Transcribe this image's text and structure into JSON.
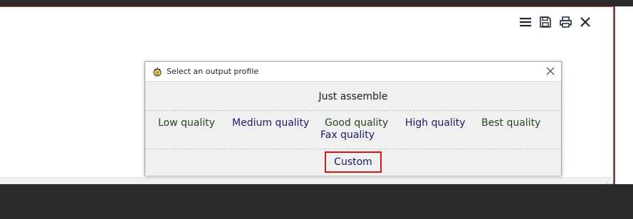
{
  "toolbar": {
    "menu_icon": "hamburger-icon",
    "save_icon": "save-icon",
    "print_icon": "print-icon",
    "close_icon": "close-icon"
  },
  "dialog": {
    "title": "Select an output profile",
    "icon": "app-logo-icon",
    "just_assemble": "Just assemble",
    "options": [
      "Low quality",
      "Medium quality",
      "Good quality",
      "High quality",
      "Best quality",
      "Fax quality"
    ],
    "custom": "Custom",
    "highlight_color": "#d6141b"
  },
  "scrollbar": {
    "arrow": "›"
  }
}
